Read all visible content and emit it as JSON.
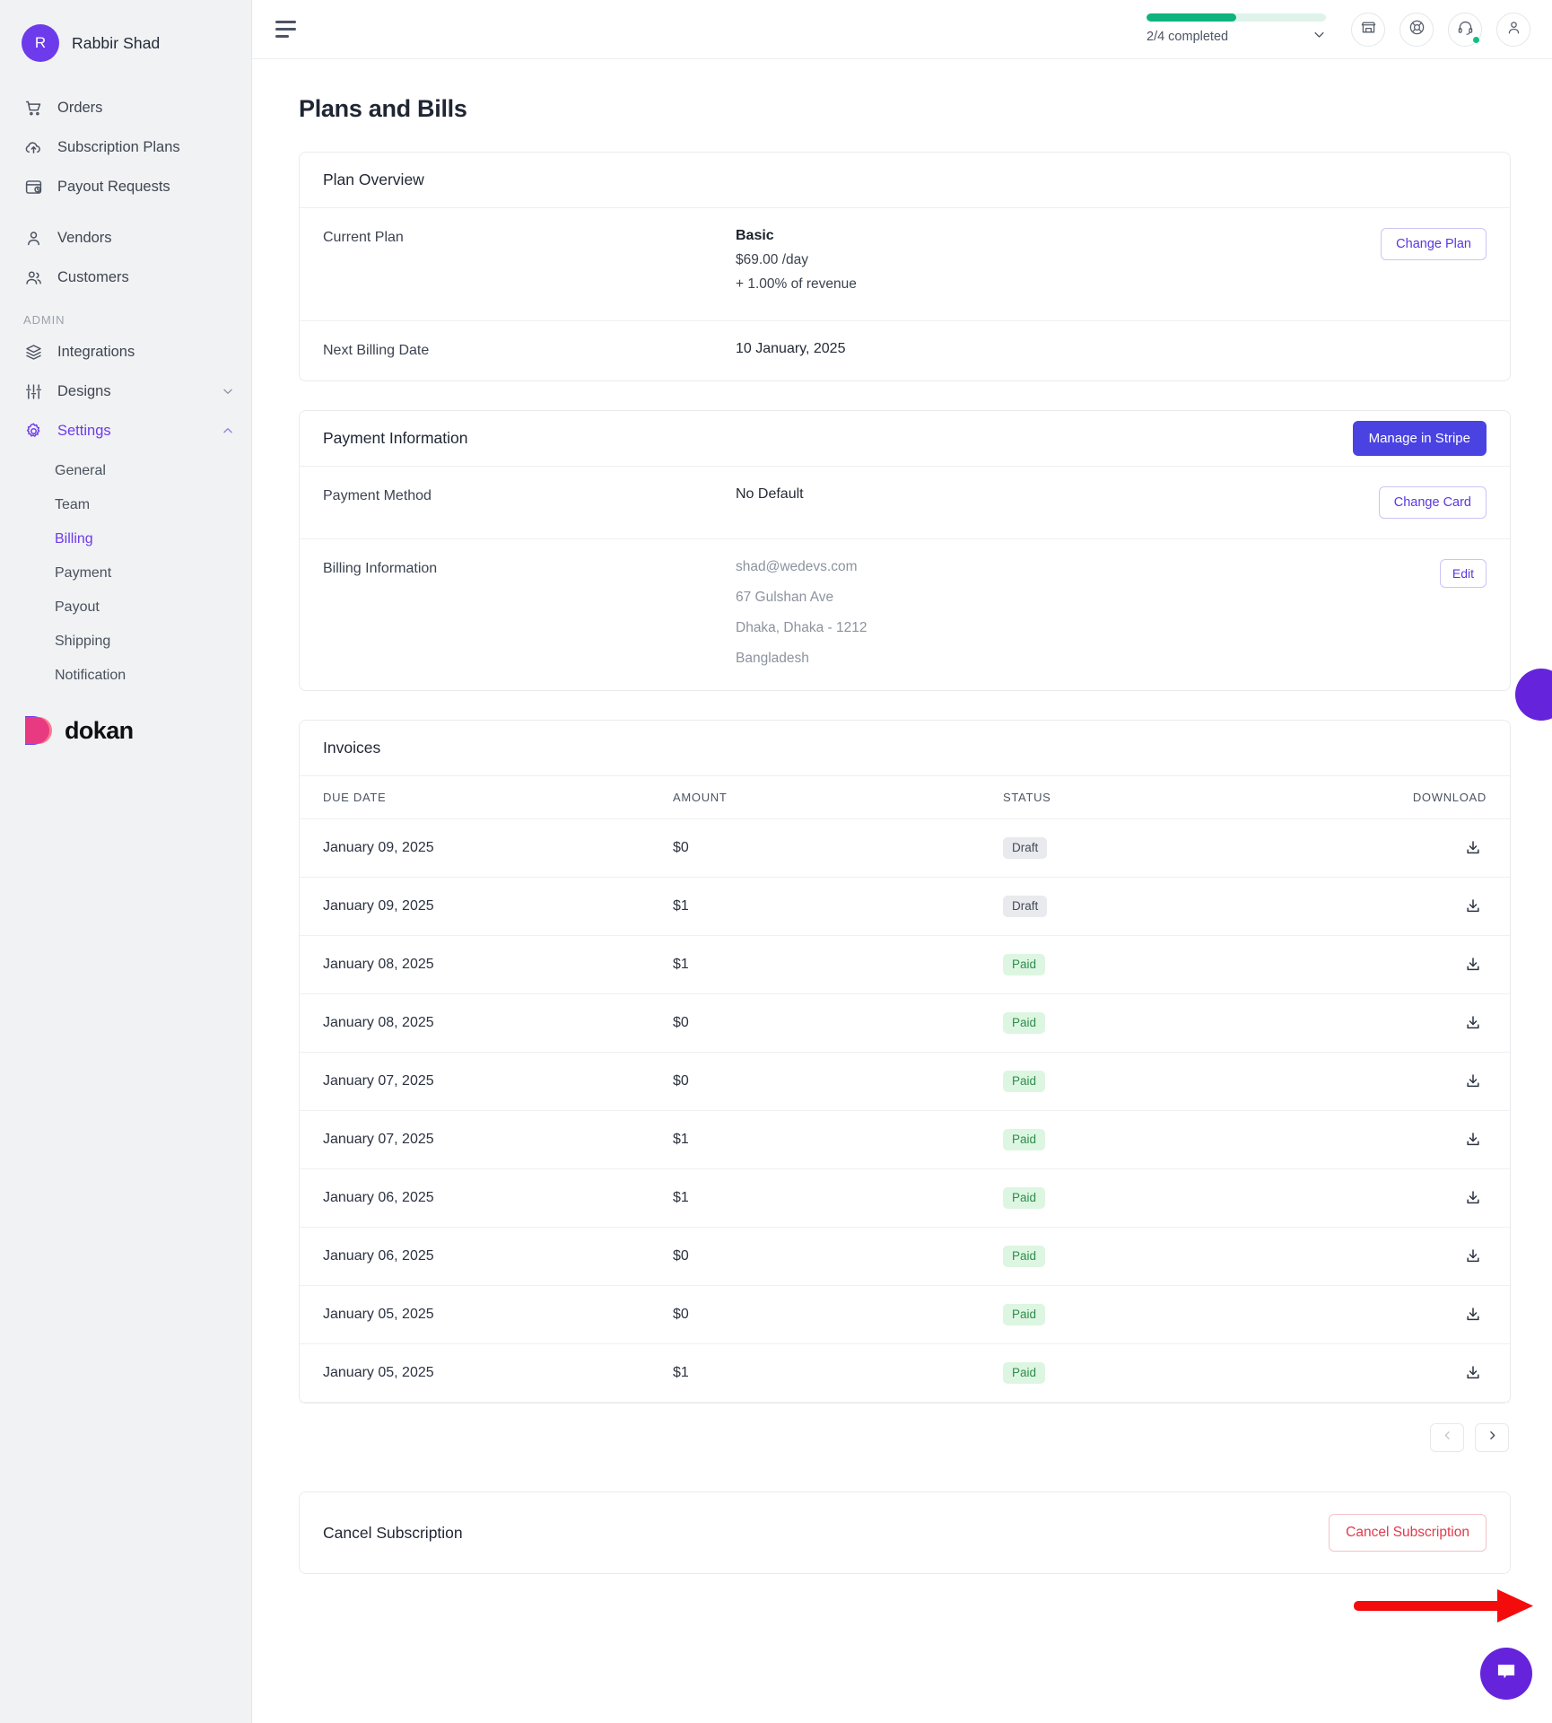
{
  "sidebar": {
    "user": {
      "initial": "R",
      "name": "Rabbir Shad",
      "avatar_color": "#6d3beb"
    },
    "nav_primary": [
      {
        "label": "Orders",
        "icon": "shopping-cart-icon"
      },
      {
        "label": "Subscription Plans",
        "icon": "cloud-upload-icon"
      },
      {
        "label": "Payout Requests",
        "icon": "payout-clock-icon"
      }
    ],
    "nav_secondary": [
      {
        "label": "Vendors",
        "icon": "user-icon"
      },
      {
        "label": "Customers",
        "icon": "users-icon"
      }
    ],
    "section_label": "ADMIN",
    "nav_admin": [
      {
        "label": "Integrations",
        "icon": "layers-icon",
        "expandable": false
      },
      {
        "label": "Designs",
        "icon": "sliders-icon",
        "expandable": true,
        "expanded": false
      },
      {
        "label": "Settings",
        "icon": "gear-icon",
        "expandable": true,
        "expanded": true,
        "active": true
      }
    ],
    "settings_submenu": [
      {
        "label": "General",
        "active": false
      },
      {
        "label": "Team",
        "active": false
      },
      {
        "label": "Billing",
        "active": true
      },
      {
        "label": "Payment",
        "active": false
      },
      {
        "label": "Payout",
        "active": false
      },
      {
        "label": "Shipping",
        "active": false
      },
      {
        "label": "Notification",
        "active": false
      }
    ],
    "brand": {
      "text": "dokan"
    },
    "accent_color": "#6d3beb"
  },
  "topbar": {
    "menu_icon": "hamburger-icon",
    "onboarding": {
      "progress_text": "2/4 completed",
      "percent": 50,
      "fill_color": "#0fb37d",
      "track_color": "#dff3ea",
      "chevron": "chevron-down-icon"
    },
    "actions": [
      {
        "icon": "store-icon",
        "badge": false
      },
      {
        "icon": "lifebuoy-icon",
        "badge": false
      },
      {
        "icon": "headset-icon",
        "badge": true
      },
      {
        "icon": "account-icon",
        "badge": false
      }
    ]
  },
  "page": {
    "title": "Plans and Bills"
  },
  "plan_overview": {
    "title": "Plan Overview",
    "rows": [
      {
        "label": "Current Plan",
        "value_title": "Basic",
        "value_price": "$69.00 /day",
        "value_extra": "+ 1.00% of revenue",
        "action": "Change Plan"
      },
      {
        "label": "Next Billing Date",
        "value_title": "10 January, 2025"
      }
    ]
  },
  "payment_information": {
    "title": "Payment Information",
    "primary_action": "Manage in Stripe",
    "payment_method": {
      "label": "Payment Method",
      "value": "No Default",
      "action": "Change Card"
    },
    "billing_information": {
      "label": "Billing Information",
      "action": "Edit",
      "lines": [
        "shad@wedevs.com",
        "67 Gulshan Ave",
        "Dhaka, Dhaka - 1212",
        "Bangladesh"
      ]
    }
  },
  "invoices": {
    "title": "Invoices",
    "columns": [
      "DUE DATE",
      "AMOUNT",
      "STATUS",
      "DOWNLOAD"
    ],
    "rows": [
      {
        "due_date": "January 09, 2025",
        "amount": "$0",
        "status": "Draft",
        "download_icon": "download-icon"
      },
      {
        "due_date": "January 09, 2025",
        "amount": "$1",
        "status": "Draft",
        "download_icon": "download-icon"
      },
      {
        "due_date": "January 08, 2025",
        "amount": "$1",
        "status": "Paid",
        "download_icon": "download-icon"
      },
      {
        "due_date": "January 08, 2025",
        "amount": "$0",
        "status": "Paid",
        "download_icon": "download-icon"
      },
      {
        "due_date": "January 07, 2025",
        "amount": "$0",
        "status": "Paid",
        "download_icon": "download-icon"
      },
      {
        "due_date": "January 07, 2025",
        "amount": "$1",
        "status": "Paid",
        "download_icon": "download-icon"
      },
      {
        "due_date": "January 06, 2025",
        "amount": "$1",
        "status": "Paid",
        "download_icon": "download-icon"
      },
      {
        "due_date": "January 06, 2025",
        "amount": "$0",
        "status": "Paid",
        "download_icon": "download-icon"
      },
      {
        "due_date": "January 05, 2025",
        "amount": "$0",
        "status": "Paid",
        "download_icon": "download-icon"
      },
      {
        "due_date": "January 05, 2025",
        "amount": "$1",
        "status": "Paid",
        "download_icon": "download-icon"
      }
    ],
    "pagination": {
      "prev_icon": "chevron-left-icon",
      "next_icon": "chevron-right-icon",
      "prev_disabled": true,
      "next_disabled": false
    },
    "status_colors": {
      "draft_bg": "#e8eaee",
      "draft_text": "#434b59",
      "paid_bg": "#ddf6e1",
      "paid_text": "#2f8c4e"
    }
  },
  "cancel_subscription": {
    "title": "Cancel Subscription",
    "button": "Cancel Subscription",
    "button_color": "#e03a4a"
  },
  "widgets": {
    "chat_icon": "chat-bubble-icon",
    "chat_color": "#6524db",
    "floating_color": "#6524db"
  },
  "annotation": {
    "type": "arrow",
    "color": "#f40b0b",
    "points_to": "Cancel Subscription"
  }
}
